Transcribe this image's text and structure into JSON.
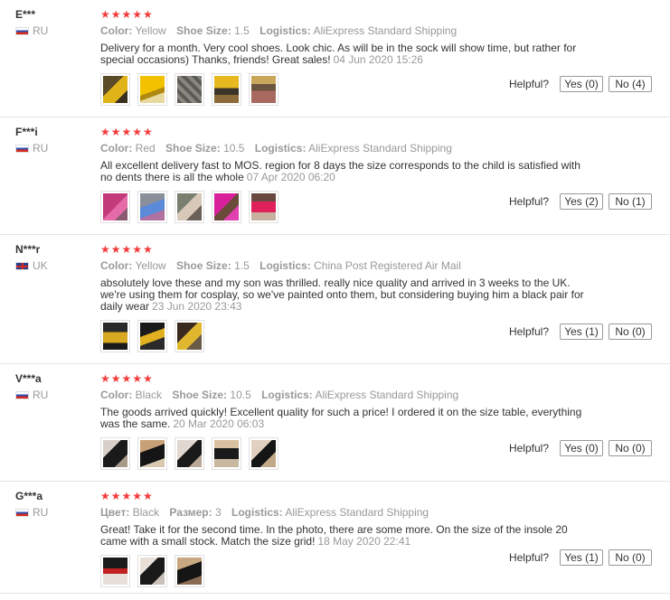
{
  "reviews": [
    {
      "user": "E***",
      "country": "RU",
      "stars": "★★★★★",
      "color_label": "Color:",
      "color_value": "Yellow",
      "size_label": "Shoe Size:",
      "size_value": "1.5",
      "logistics_label": "Logistics:",
      "logistics_value": "AliExpress Standard Shipping",
      "text": "Delivery for a month. Very cool shoes. Look chic. As will be in the sock will show time, but rather for special occasions) Thanks, friends! Great sales!",
      "date": "04 Jun 2020 15:26",
      "helpful_label": "Helpful?",
      "yes_label": "Yes (0)",
      "no_label": "No (4)"
    },
    {
      "user": "F***i",
      "country": "RU",
      "stars": "★★★★★",
      "color_label": "Color:",
      "color_value": "Red",
      "size_label": "Shoe Size:",
      "size_value": "10.5",
      "logistics_label": "Logistics:",
      "logistics_value": "AliExpress Standard Shipping",
      "text": "All excellent delivery fast to MOS. region for 8 days the size corresponds to the child is satisfied with no dents there is all the whole",
      "date": "07 Apr 2020 06:20",
      "helpful_label": "Helpful?",
      "yes_label": "Yes (2)",
      "no_label": "No (1)"
    },
    {
      "user": "N***r",
      "country": "UK",
      "stars": "★★★★★",
      "color_label": "Color:",
      "color_value": "Yellow",
      "size_label": "Shoe Size:",
      "size_value": "1.5",
      "logistics_label": "Logistics:",
      "logistics_value": "China Post Registered Air Mail",
      "text": "absolutely love these and my son was thrilled. really nice quality and arrived in 3 weeks to the UK. we're using them for cosplay, so we've painted onto them, but considering buying him a black pair for daily wear",
      "date": "23 Jun 2020 23:43",
      "helpful_label": "Helpful?",
      "yes_label": "Yes (1)",
      "no_label": "No (0)"
    },
    {
      "user": "V***a",
      "country": "RU",
      "stars": "★★★★★",
      "color_label": "Color:",
      "color_value": "Black",
      "size_label": "Shoe Size:",
      "size_value": "10.5",
      "logistics_label": "Logistics:",
      "logistics_value": "AliExpress Standard Shipping",
      "text": "The goods arrived quickly! Excellent quality for such a price! I ordered it on the size table, everything was the same.",
      "date": "20 Mar 2020 06:03",
      "helpful_label": "Helpful?",
      "yes_label": "Yes (0)",
      "no_label": "No (0)"
    },
    {
      "user": "G***a",
      "country": "RU",
      "stars": "★★★★★",
      "color_label": "Цвет:",
      "color_value": "Black",
      "size_label": "Размер:",
      "size_value": "3",
      "logistics_label": "Logistics:",
      "logistics_value": "AliExpress Standard Shipping",
      "text": "Great! Take it for the second time. In the photo, there are some more. On the size of the insole 20 came with a small stock. Match the size grid!",
      "date": "18 May 2020 22:41",
      "helpful_label": "Helpful?",
      "yes_label": "Yes (1)",
      "no_label": "No (0)"
    }
  ],
  "colors": {
    "star": "#f33b3b",
    "muted": "#999999",
    "text": "#333333",
    "divider": "#e5e5e5"
  }
}
